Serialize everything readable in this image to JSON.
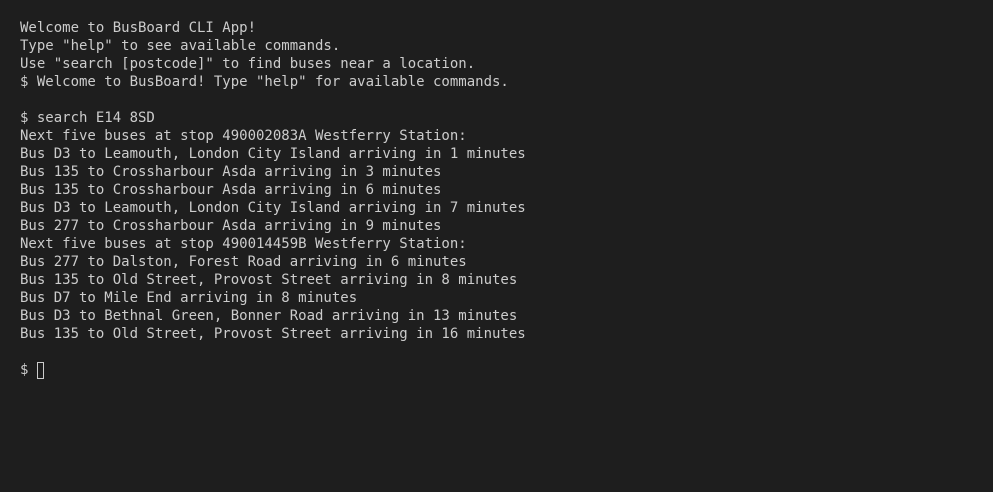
{
  "terminal": {
    "lines": [
      "Welcome to BusBoard CLI App!",
      "Type \"help\" to see available commands.",
      "Use \"search [postcode]\" to find buses near a location.",
      "$ Welcome to BusBoard! Type \"help\" for available commands.",
      "",
      "$ search E14 8SD",
      "Next five buses at stop 490002083A Westferry Station:",
      "Bus D3 to Leamouth, London City Island arriving in 1 minutes",
      "Bus 135 to Crossharbour Asda arriving in 3 minutes",
      "Bus 135 to Crossharbour Asda arriving in 6 minutes",
      "Bus D3 to Leamouth, London City Island arriving in 7 minutes",
      "Bus 277 to Crossharbour Asda arriving in 9 minutes",
      "Next five buses at stop 490014459B Westferry Station:",
      "Bus 277 to Dalston, Forest Road arriving in 6 minutes",
      "Bus 135 to Old Street, Provost Street arriving in 8 minutes",
      "Bus D7 to Mile End arriving in 8 minutes",
      "Bus D3 to Bethnal Green, Bonner Road arriving in 13 minutes",
      "Bus 135 to Old Street, Provost Street arriving in 16 minutes",
      ""
    ],
    "prompt": "$",
    "colors": {
      "background": "#1e1e1e",
      "text": "#cccccc"
    }
  }
}
